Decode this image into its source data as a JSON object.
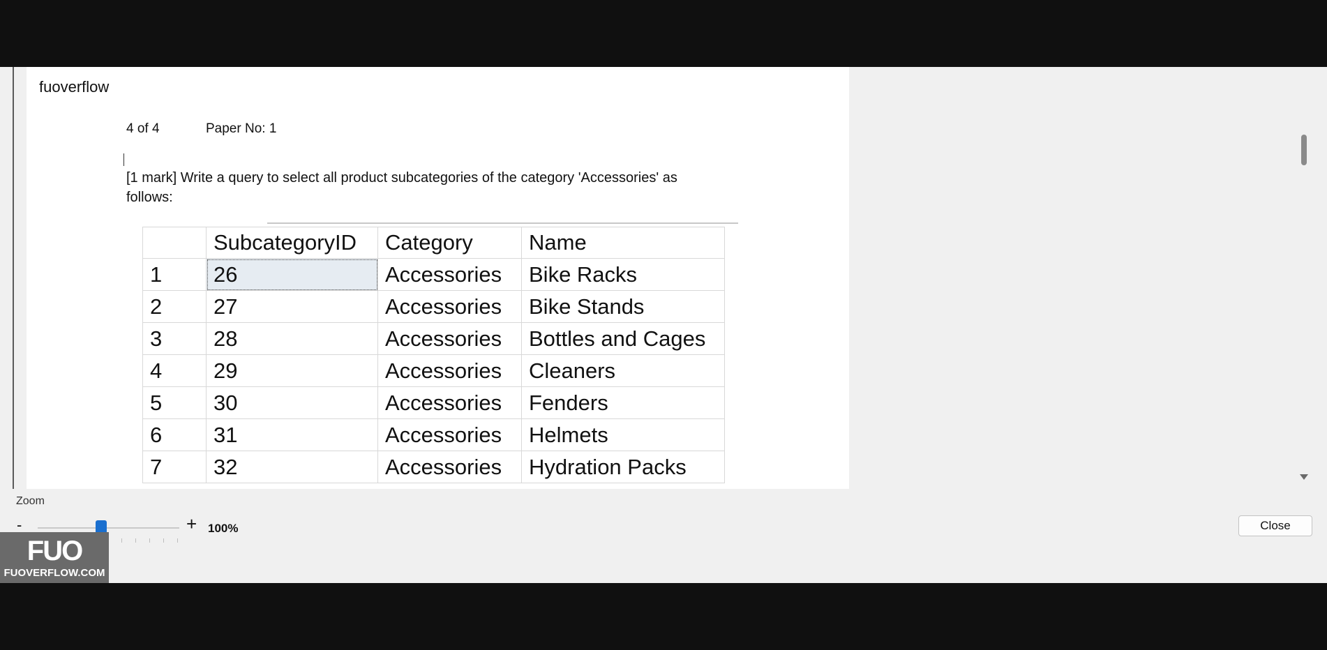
{
  "watermark": "fuoverflow",
  "page": {
    "page_of": "4 of 4",
    "paper_no": "Paper No: 1",
    "question_line1": "[1 mark] Write a query to select all product subcategories of the category 'Accessories' as",
    "question_line2": "follows:"
  },
  "result_grid": {
    "columns": [
      "",
      "SubcategoryID",
      "Category",
      "Name"
    ],
    "rows": [
      {
        "num": "1",
        "id": "26",
        "category": "Accessories",
        "name": "Bike Racks"
      },
      {
        "num": "2",
        "id": "27",
        "category": "Accessories",
        "name": "Bike Stands"
      },
      {
        "num": "3",
        "id": "28",
        "category": "Accessories",
        "name": "Bottles and Cages"
      },
      {
        "num": "4",
        "id": "29",
        "category": "Accessories",
        "name": "Cleaners"
      },
      {
        "num": "5",
        "id": "30",
        "category": "Accessories",
        "name": "Fenders"
      },
      {
        "num": "6",
        "id": "31",
        "category": "Accessories",
        "name": "Helmets"
      },
      {
        "num": "7",
        "id": "32",
        "category": "Accessories",
        "name": "Hydration Packs"
      }
    ]
  },
  "zoom": {
    "label": "Zoom",
    "minus": "-",
    "plus": "+",
    "value_text": "100%",
    "slider_fraction": 0.45
  },
  "close_label": "Close",
  "logo": {
    "mark": "FUO",
    "text": "FUOVERFLOW.COM"
  },
  "colors": {
    "slider_thumb": "#1a6fcf",
    "selection": "#e6ecf2"
  }
}
